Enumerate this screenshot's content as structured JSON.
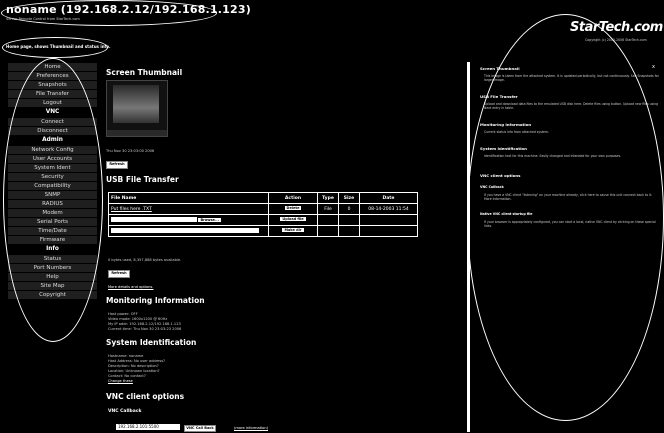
{
  "header": {
    "title": "noname (192.168.2.12/192.168.1.123)",
    "subtitle": "Server Remote Control from StarTech.com",
    "intro": "Home page, shows Thumbnail and status info."
  },
  "brand": {
    "logo": "StarTech.com",
    "copyright": "Copyright (c) 2003-2006 StarTech.com"
  },
  "sidebar": {
    "group1": [
      "Home",
      "Preferences",
      "Snapshots",
      "File Transfer",
      "Logout"
    ],
    "vnc_head": "VNC",
    "vnc": [
      "Connect",
      "Disconnect"
    ],
    "admin_head": "Admin",
    "admin": [
      "Network Config",
      "User Accounts",
      "System Ident",
      "Security",
      "Compatibility",
      "SNMP",
      "RADIUS",
      "Modem",
      "Serial Ports",
      "Time/Date",
      "Firmware"
    ],
    "info_head": "Info",
    "info": [
      "Status",
      "Port Numbers",
      "Help",
      "Site Map",
      "Copyright"
    ]
  },
  "main": {
    "thumbnail": {
      "heading": "Screen Thumbnail",
      "timestamp": "Thu Nov 30 23:03:00 2006",
      "refresh": "Refresh"
    },
    "file_transfer": {
      "heading": "USB File Transfer",
      "columns": [
        "File Name",
        "Action",
        "Type",
        "Size",
        "Date"
      ],
      "row": {
        "name": "Put files here .TXT",
        "action": "Delete",
        "type": "File",
        "size": "0",
        "date": "08-14-2003 11:54"
      },
      "browse": "Browse...",
      "upload": "Upload file",
      "makedir": "Make dir",
      "bytes_info": "0 bytes used, 8,357,888 bytes available.",
      "refresh": "Refresh",
      "more_link": "More details and options."
    },
    "monitoring": {
      "heading": "Monitoring Information",
      "lines": [
        "Host power: OFF",
        "Video mode: 1600x1200 @ 60Hz",
        "My IP addr: 192.168.2.12/192.168.1.123",
        "Current time: Thu Nov 30 23:03:23 2006"
      ]
    },
    "system": {
      "heading": "System Identification",
      "lines": [
        "Hostname: noname",
        "Host Address: No user address?",
        "Description: No description?",
        "Location: Unknown location?",
        "Contact: No contact?"
      ],
      "change": "Change these"
    },
    "vnc_options": {
      "heading": "VNC client options",
      "callback_heading": "VNC Callback",
      "callback_value": "192.168.2.101:5500",
      "callback_button": "VNC Call Back",
      "more": "(more information)"
    }
  },
  "help": {
    "close": "x",
    "sections": [
      {
        "h": "Screen Thumbnail",
        "t": "This image is taken from the attached system. It is updated periodically, but not continuously. See Snapshots for larger image."
      },
      {
        "h": "USB File Transfer",
        "t": "Upload and download data files to the emulated USB disk here. Delete files using button. Upload new files using Next entry in table."
      },
      {
        "h": "Monitoring Information",
        "t": "Current status info from attached system."
      },
      {
        "h": "System Identification",
        "t": "Identification text for this machine. Easily changed and intended for your own purposes."
      },
      {
        "h": "VNC client options",
        "t": ""
      },
      {
        "h": "VNC Callback",
        "t": "If you have a VNC client \"listening\" on your machine already, click here to cause this unit connect back to it. More information."
      },
      {
        "h": "Native VNC client startup file",
        "t": "If your browser is appropriately configured, you can start a local, native VNC client by clicking on these special links."
      }
    ]
  }
}
